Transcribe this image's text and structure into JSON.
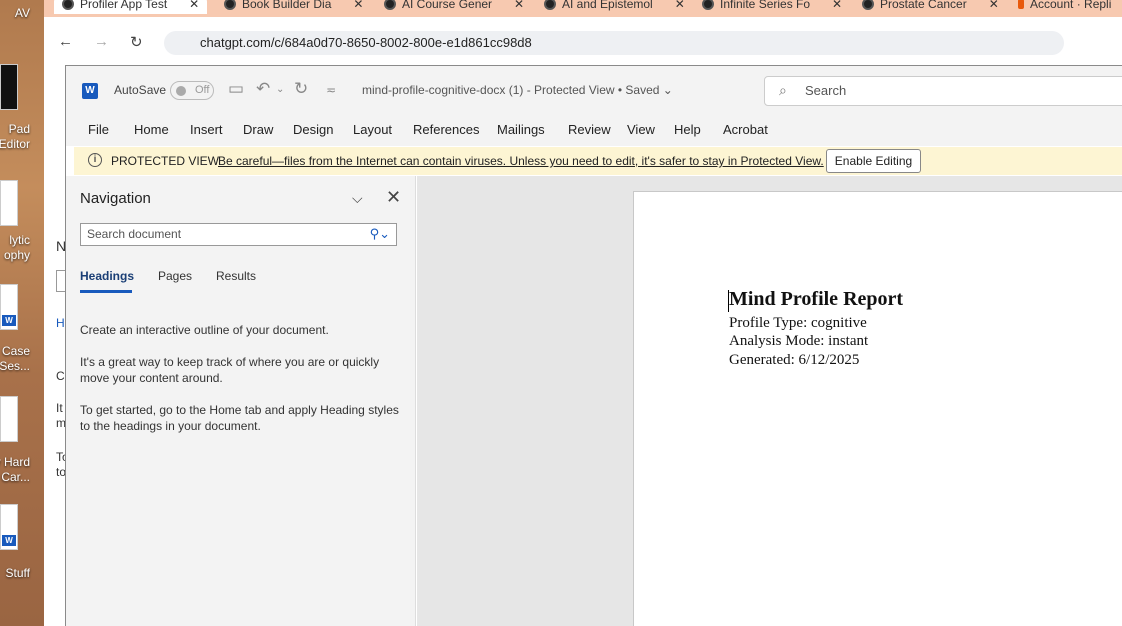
{
  "desktop": {
    "labels": [
      "AV",
      "Pad\nEditor",
      "lytic\nophy",
      "a Case\nSes...",
      "y Hard\nCar...",
      "Stuff"
    ]
  },
  "browser": {
    "tabs": [
      {
        "label": "Profiler App Test",
        "active": true
      },
      {
        "label": "Book Builder Dia"
      },
      {
        "label": "AI Course Gener"
      },
      {
        "label": "AI and Epistemol"
      },
      {
        "label": "Infinite Series Fo"
      },
      {
        "label": "Prostate Cancer"
      },
      {
        "label": "Account · Repli"
      }
    ],
    "url": "chatgpt.com/c/684a0d70-8650-8002-800e-e1d861cc98d8",
    "side_letters": [
      "N",
      "H",
      "C",
      "It",
      "m",
      "To",
      "to"
    ]
  },
  "word": {
    "autosave_label": "AutoSave",
    "autosave_state": "Off",
    "doc_title": "mind-profile-cognitive-docx (1)  -  Protected View  •  Saved",
    "search_placeholder": "Search",
    "menu": [
      "File",
      "Home",
      "Insert",
      "Draw",
      "Design",
      "Layout",
      "References",
      "Mailings",
      "Review",
      "View",
      "Help",
      "Acrobat"
    ],
    "protected": {
      "title": "PROTECTED VIEW",
      "message": "Be careful—files from the Internet can contain viruses. Unless you need to edit, it's safer to stay in Protected View.",
      "button": "Enable Editing"
    },
    "navigation": {
      "title": "Navigation",
      "search_placeholder": "Search document",
      "tabs": [
        "Headings",
        "Pages",
        "Results"
      ],
      "paragraphs": [
        "Create an interactive outline of your document.",
        "It's a great way to keep track of where you are or quickly move your content around.",
        "To get started, go to the Home tab and apply Heading styles to the headings in your document."
      ]
    },
    "document": {
      "heading": "Mind Profile Report",
      "lines": [
        "Profile Type: cognitive",
        "Analysis Mode: instant",
        "Generated: 6/12/2025"
      ]
    }
  },
  "colors": {
    "word_blue": "#185abd",
    "protected_bg": "#fdf5d3",
    "chrome_tab_bg": "#f7c9b0"
  }
}
